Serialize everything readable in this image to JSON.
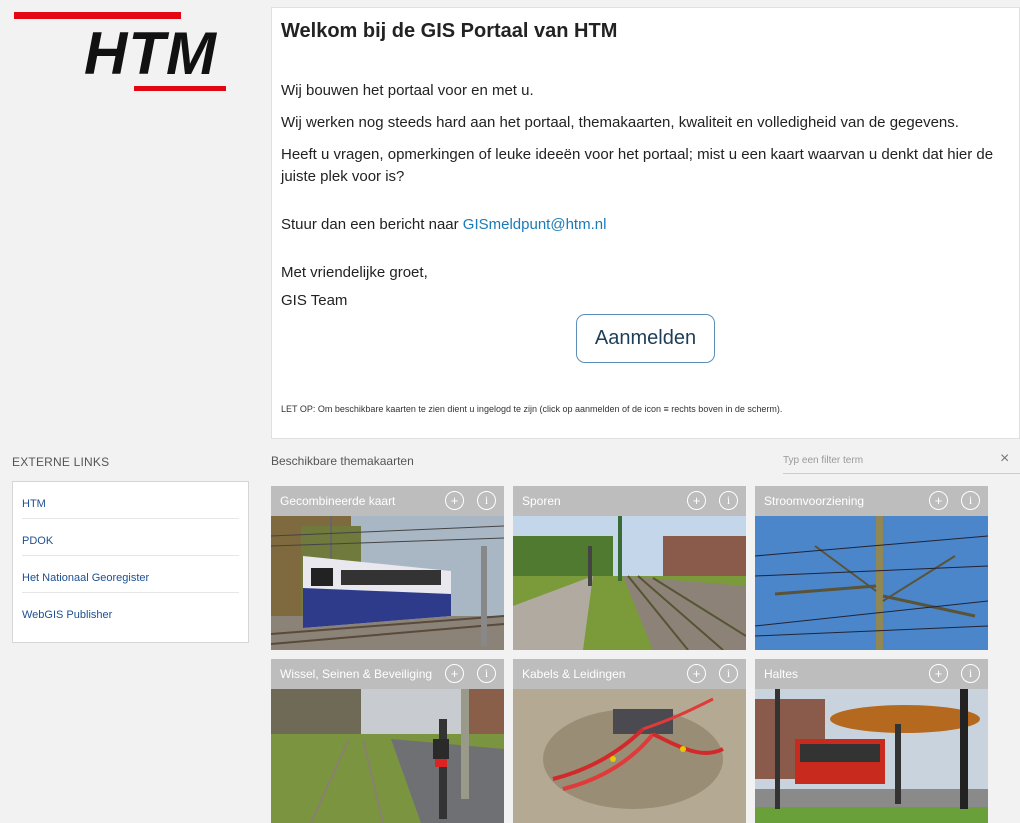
{
  "logo": {
    "text": "HTM"
  },
  "welcome": {
    "title": "Welkom bij de GIS Portaal van HTM",
    "p1": "Wij bouwen het portaal voor en met u.",
    "p2": "Wij werken nog steeds hard aan het portaal, themakaarten, kwaliteit en volledigheid van de gegevens.",
    "p3": "Heeft u vragen, opmerkingen of leuke ideeën voor het portaal;  mist u een kaart waarvan u denkt dat hier de juiste plek voor is?",
    "p4_prefix": "Stuur dan een bericht naar ",
    "email": "GISmeldpunt@htm.nl",
    "greeting": "Met vriendelijke groet,",
    "signature": "GIS Team",
    "login_button": "Aanmelden",
    "note": "LET OP: Om beschikbare kaarten te zien dient u ingelogd te zijn (click op aanmelden of de icon  ≡  rechts boven in de scherm)."
  },
  "external_links": {
    "title": "EXTERNE LINKS",
    "items": [
      {
        "label": "HTM"
      },
      {
        "label": "PDOK"
      },
      {
        "label": "Het Nationaal Georegister"
      },
      {
        "label": "WebGIS Publisher"
      }
    ]
  },
  "maps": {
    "title": "Beschikbare themakaarten",
    "filter_placeholder": "Typ een filter term",
    "clear_icon": "×",
    "add_icon": "+",
    "info_icon": "i",
    "cards": [
      {
        "title": "Gecombineerde kaart",
        "image": "tram-photo"
      },
      {
        "title": "Sporen",
        "image": "tracks-photo"
      },
      {
        "title": "Stroomvoorziening",
        "image": "overhead-wires-photo"
      },
      {
        "title": "Wissel, Seinen & Beveiliging",
        "image": "signal-photo"
      },
      {
        "title": "Kabels & Leidingen",
        "image": "cables-photo"
      },
      {
        "title": "Haltes",
        "image": "tram-stop-photo"
      }
    ]
  }
}
